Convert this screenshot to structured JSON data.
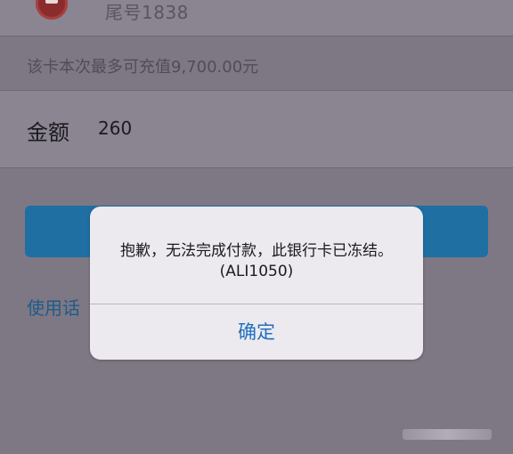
{
  "card": {
    "tail_label": "尾号1838"
  },
  "hint": {
    "text": "该卡本次最多可充值9,700.00元"
  },
  "amount": {
    "label": "金额",
    "value": "260"
  },
  "link": {
    "text": "使用话"
  },
  "dialog": {
    "message": "抱歉，无法完成付款，此银行卡已冻结。",
    "code": "(ALI1050)",
    "ok_label": "确定"
  },
  "colors": {
    "accent": "#1f6fc0",
    "button_blue": "#1f6fa3",
    "bank_logo_red": "#8c2b2b"
  },
  "icons": {
    "bank_logo": "bank-logo-icon"
  }
}
